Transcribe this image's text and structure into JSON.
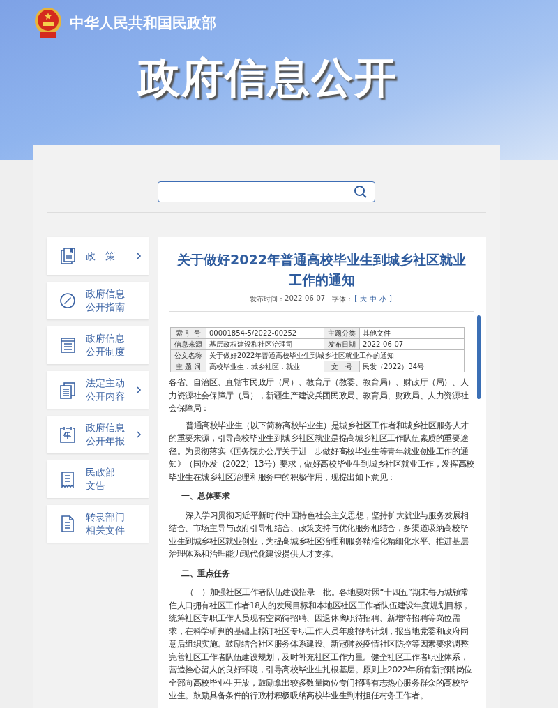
{
  "header": {
    "ministry": "中华人民共和国民政部",
    "banner_title": "政府信息公开"
  },
  "sidebar": {
    "items": [
      {
        "lines": [
          "政　策"
        ],
        "has_arrow": true
      },
      {
        "lines": [
          "政府信息",
          "公开指南"
        ],
        "has_arrow": false
      },
      {
        "lines": [
          "政府信息",
          "公开制度"
        ],
        "has_arrow": false
      },
      {
        "lines": [
          "法定主动",
          "公开内容"
        ],
        "has_arrow": true
      },
      {
        "lines": [
          "政府信息",
          "公开年报"
        ],
        "has_arrow": true
      },
      {
        "lines": [
          "民政部",
          "文告"
        ],
        "has_arrow": false
      },
      {
        "lines": [
          "转隶部门",
          "相关文件"
        ],
        "has_arrow": false
      }
    ]
  },
  "article": {
    "title": "关于做好2022年普通高校毕业生到城乡社区就业工作的通知",
    "meta": {
      "date_label": "发布时间：",
      "date": "2022-06-07",
      "font_label": "字体：",
      "font_open": "[",
      "sizes": [
        "大",
        "中",
        "小"
      ],
      "font_close": "]"
    },
    "info_table": {
      "rows": [
        [
          {
            "label": "索 引 号",
            "value": "00001854-5/2022-00252"
          },
          {
            "label": "主题分类",
            "value": "其他文件"
          }
        ],
        [
          {
            "label": "信息来源",
            "value": "基层政权建设和社区治理司"
          },
          {
            "label": "发布日期",
            "value": "2022-06-07"
          }
        ],
        [
          {
            "label": "公文名称",
            "value": "关于做好2022年普通高校毕业生到城乡社区就业工作的通知"
          }
        ],
        [
          {
            "label": "主 题 词",
            "value": "高校毕业生．城乡社区．就业"
          },
          {
            "label": "文　号",
            "value": "民发（2022）34号"
          }
        ]
      ]
    },
    "body": [
      {
        "kind": "salutation",
        "text": "各省、自治区、直辖市民政厅（局）、教育厅（教委、教育局）、财政厅（局）、人力资源社会保障厅（局），新疆生产建设兵团民政局、教育局、财政局、人力资源社会保障局："
      },
      {
        "kind": "paragraph",
        "text": "普通高校毕业生（以下简称高校毕业生）是城乡社区工作者和城乡社区服务人才的重要来源，引导高校毕业生到城乡社区就业是提高城乡社区工作队伍素质的重要途径。为贯彻落实《国务院办公厅关于进一步做好高校毕业生等青年就业创业工作的通知》（国办发（2022）13号）要求，做好高校毕业生到城乡社区就业工作，发挥高校毕业生在城乡社区治理和服务中的积极作用，现提出如下意见："
      },
      {
        "kind": "heading",
        "text": "一、总体要求"
      },
      {
        "kind": "paragraph",
        "text": "深入学习贯彻习近平新时代中国特色社会主义思想，坚持扩大就业与服务发展相结合、市场主导与政府引导相结合、政策支持与优化服务相结合，多渠道吸纳高校毕业生到城乡社区就业创业，为提高城乡社区治理和服务精准化精细化水平、推进基层治理体系和治理能力现代化建设提供人才支撑。"
      },
      {
        "kind": "heading",
        "text": "二、重点任务"
      },
      {
        "kind": "paragraph",
        "text": "（一）加强社区工作者队伍建设招录一批。各地要对照“十四五”期末每万城镇常住人口拥有社区工作者18人的发展目标和本地区社区工作者队伍建设年度规划目标，统筹社区专职工作人员现有空岗待招聘、因退休离职待招聘、新增待招聘等岗位需求，在科学研判的基础上拟订社区专职工作人员年度招聘计划，报当地党委和政府同意后组织实施。鼓励结合社区服务体系建设、新冠肺炎疫情社区防控等因素要求调整完善社区工作者队伍建设规划，及时补充社区工作力量。健全社区工作者职业体系，营造拴心留人的良好环境，引导高校毕业生扎根基层。原则上2022年所有新招聘岗位全部向高校毕业生开放，鼓励拿出较多数量岗位专门招聘有志热心服务群众的高校毕业生。鼓励具备条件的行政村积极吸纳高校毕业生到村担任村务工作者。"
      }
    ]
  }
}
